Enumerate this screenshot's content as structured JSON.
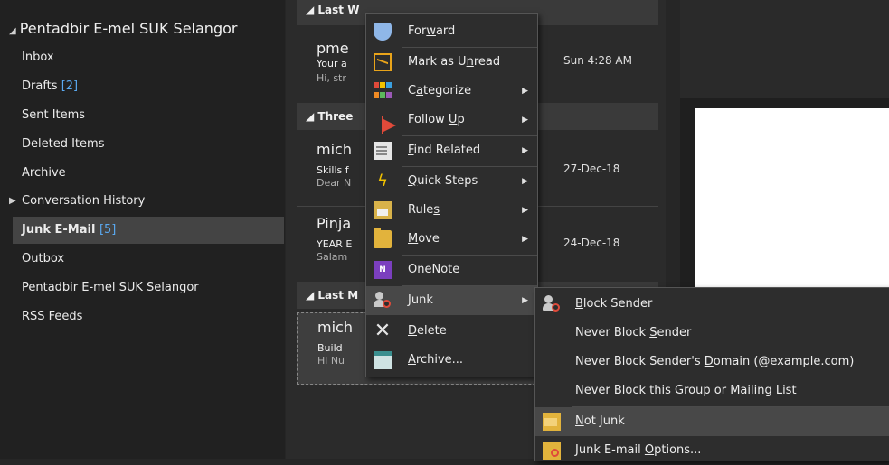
{
  "folders": {
    "root": "Pentadbir E-mel SUK Selangor",
    "items": [
      {
        "label": "Inbox",
        "count": ""
      },
      {
        "label": "Drafts",
        "count": "[2]"
      },
      {
        "label": "Sent Items",
        "count": ""
      },
      {
        "label": "Deleted Items",
        "count": ""
      },
      {
        "label": "Archive",
        "count": ""
      },
      {
        "label": "Conversation History",
        "count": ""
      },
      {
        "label": "Junk E-Mail",
        "count": "[5]"
      },
      {
        "label": "Outbox",
        "count": ""
      },
      {
        "label": "Pentadbir E-mel SUK Selangor",
        "count": ""
      },
      {
        "label": "RSS Feeds",
        "count": ""
      }
    ]
  },
  "list": {
    "groups": [
      "Last W",
      "Three",
      "Last M"
    ],
    "messages": [
      {
        "sender": "pme",
        "subject": "Your a",
        "preview": "Hi, str",
        "date": "Sun 4:28 AM"
      },
      {
        "sender": "mich",
        "subject": "Skills f",
        "preview": "Dear N",
        "date": "27-Dec-18"
      },
      {
        "sender": "Pinja",
        "subject": "YEAR E",
        "preview": "Salam",
        "date": "24-Dec-18"
      },
      {
        "sender": "mich",
        "subject": "Build",
        "preview": "Hi Nu",
        "date": ""
      }
    ]
  },
  "context_menu": {
    "items": [
      {
        "pre": "For",
        "ul": "w",
        "post": "ard",
        "icon": "forward-icon"
      },
      {
        "pre": "Mark as U",
        "ul": "n",
        "post": "read",
        "icon": "envelope-icon"
      },
      {
        "pre": "C",
        "ul": "a",
        "post": "tegorize",
        "icon": "categorize-icon"
      },
      {
        "pre": "Follow ",
        "ul": "U",
        "post": "p",
        "icon": "flag-icon"
      },
      {
        "pre": "",
        "ul": "F",
        "post": "ind Related",
        "icon": "find-related-icon"
      },
      {
        "pre": "",
        "ul": "Q",
        "post": "uick Steps",
        "icon": "lightning-icon"
      },
      {
        "pre": "Rule",
        "ul": "s",
        "post": "",
        "icon": "rules-icon"
      },
      {
        "pre": "",
        "ul": "M",
        "post": "ove",
        "icon": "move-folder-icon"
      },
      {
        "pre": "One",
        "ul": "N",
        "post": "ote",
        "icon": "onenote-icon"
      },
      {
        "pre": "",
        "ul": "J",
        "post": "unk",
        "icon": "junk-icon"
      },
      {
        "pre": "",
        "ul": "D",
        "post": "elete",
        "icon": "delete-icon"
      },
      {
        "pre": "",
        "ul": "A",
        "post": "rchive...",
        "icon": "archive-icon"
      }
    ]
  },
  "junk_submenu": {
    "items": [
      {
        "pre": "",
        "ul": "B",
        "post": "lock Sender"
      },
      {
        "pre": "Never Block ",
        "ul": "S",
        "post": "ender"
      },
      {
        "pre": "Never Block Sender's ",
        "ul": "D",
        "post": "omain (@example.com)"
      },
      {
        "pre": "Never Block this Group or ",
        "ul": "M",
        "post": "ailing List"
      },
      {
        "pre": "",
        "ul": "N",
        "post": "ot Junk"
      },
      {
        "pre": "Junk E-mail ",
        "ul": "O",
        "post": "ptions..."
      }
    ]
  },
  "colors": {
    "accent": "#5aa9f0",
    "flag": "#e04a3a",
    "folder": "#e2b33c"
  }
}
